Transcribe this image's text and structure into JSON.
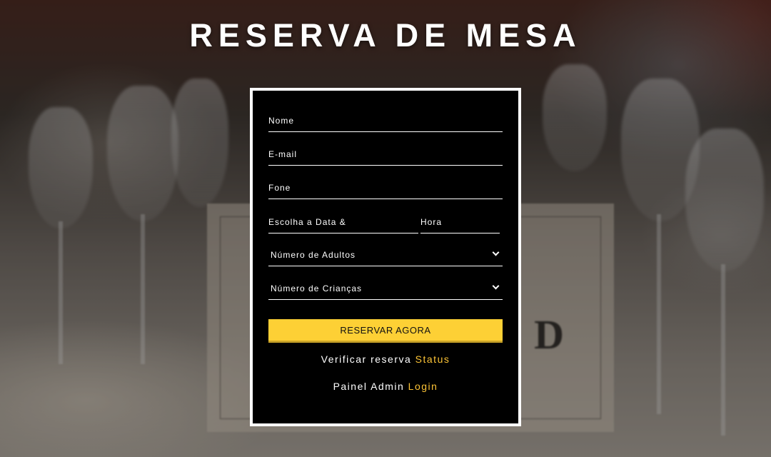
{
  "page_title": "RESERVA DE MESA",
  "form": {
    "name_placeholder": "Nome",
    "email_placeholder": "E-mail",
    "phone_placeholder": "Fone",
    "date_placeholder": "Escolha a Data &",
    "time_placeholder": "Hora",
    "adults_select": "Número de Adultos",
    "children_select": "Número de Crianças",
    "submit_label": "RESERVAR AGORA"
  },
  "links": {
    "status_prefix": "Verificar reserva",
    "status_link": "Status",
    "admin_prefix": "Painel Admin",
    "admin_link": "Login"
  },
  "colors": {
    "accent": "#fdd035",
    "link": "#fdc436",
    "panel_bg": "#000000"
  },
  "icons": {
    "select_arrow": "chevron-down-icon"
  }
}
